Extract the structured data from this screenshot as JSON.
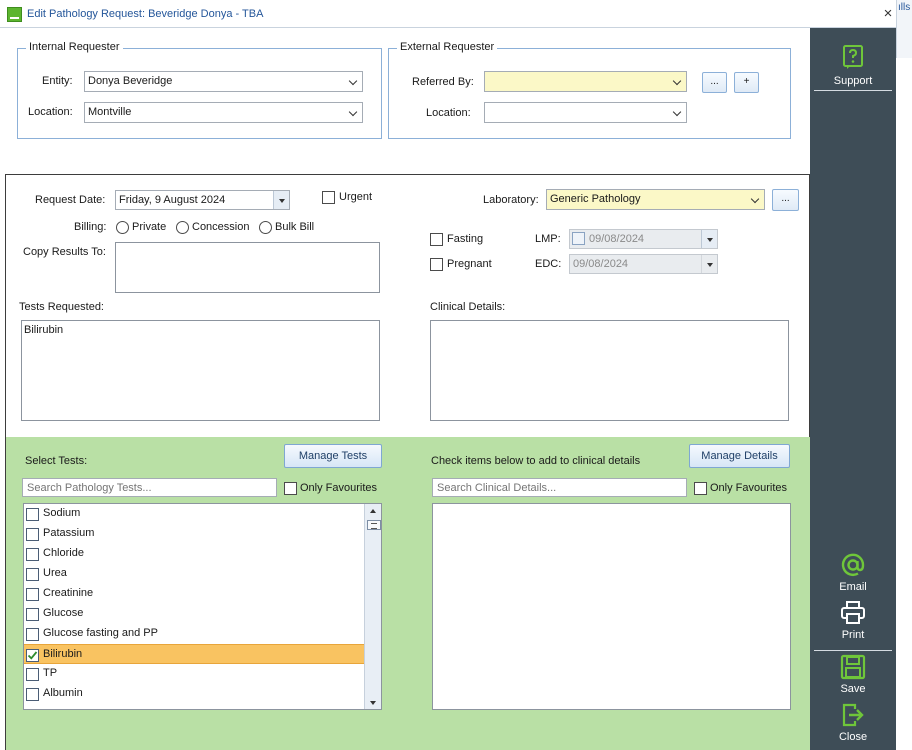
{
  "window": {
    "title": "Edit Pathology Request: Beveridge Donya - TBA",
    "close_label": "×",
    "background_fragment": "ılls"
  },
  "internal_requester": {
    "legend": "Internal Requester",
    "entity_label": "Entity:",
    "entity_value": "Donya Beveridge",
    "location_label": "Location:",
    "location_value": "Montville"
  },
  "external_requester": {
    "legend": "External Requester",
    "referred_by_label": "Referred By:",
    "referred_by_value": "",
    "browse_label": "...",
    "add_label": "+",
    "location_label": "Location:",
    "location_value": ""
  },
  "request": {
    "date_label": "Request Date:",
    "date_value": "Friday, 9 August 2024",
    "urgent_label": "Urgent",
    "billing_label": "Billing:",
    "billing_options": [
      "Private",
      "Concession",
      "Bulk Bill"
    ],
    "copy_results_label": "Copy Results To:",
    "laboratory_label": "Laboratory:",
    "laboratory_value": "Generic Pathology",
    "laboratory_browse_label": "...",
    "fasting_label": "Fasting",
    "pregnant_label": "Pregnant",
    "lmp_label": "LMP:",
    "lmp_value": "09/08/2024",
    "edc_label": "EDC:",
    "edc_value": "09/08/2024",
    "tests_requested_label": "Tests Requested:",
    "tests_requested_value": "Bilirubin",
    "clinical_details_label": "Clinical Details:"
  },
  "select_tests": {
    "label": "Select Tests:",
    "manage_button": "Manage Tests",
    "search_placeholder": "Search Pathology Tests...",
    "only_favourites_label": "Only Favourites",
    "items": [
      {
        "name": "Sodium",
        "checked": false
      },
      {
        "name": "Patassium",
        "checked": false
      },
      {
        "name": "Chloride",
        "checked": false
      },
      {
        "name": "Urea",
        "checked": false
      },
      {
        "name": "Creatinine",
        "checked": false
      },
      {
        "name": "Glucose",
        "checked": false
      },
      {
        "name": "Glucose fasting and PP",
        "checked": false
      },
      {
        "name": "Bilirubin",
        "checked": true
      },
      {
        "name": "TP",
        "checked": false
      },
      {
        "name": "Albumin",
        "checked": false
      }
    ]
  },
  "clinical_details_picker": {
    "label": "Check items below to add to clinical details",
    "manage_button": "Manage Details",
    "search_placeholder": "Search Clinical Details...",
    "only_favourites_label": "Only Favourites"
  },
  "sidebar": {
    "support_label": "Support",
    "email_label": "Email",
    "print_label": "Print",
    "save_label": "Save",
    "close_label": "Close"
  },
  "colors": {
    "accent_green": "#5cb52f",
    "sidebar_bg": "#3e4d57",
    "panel_green": "#b9e0a5",
    "selection_orange": "#f9c361",
    "required_yellow": "#fbf8c7"
  }
}
